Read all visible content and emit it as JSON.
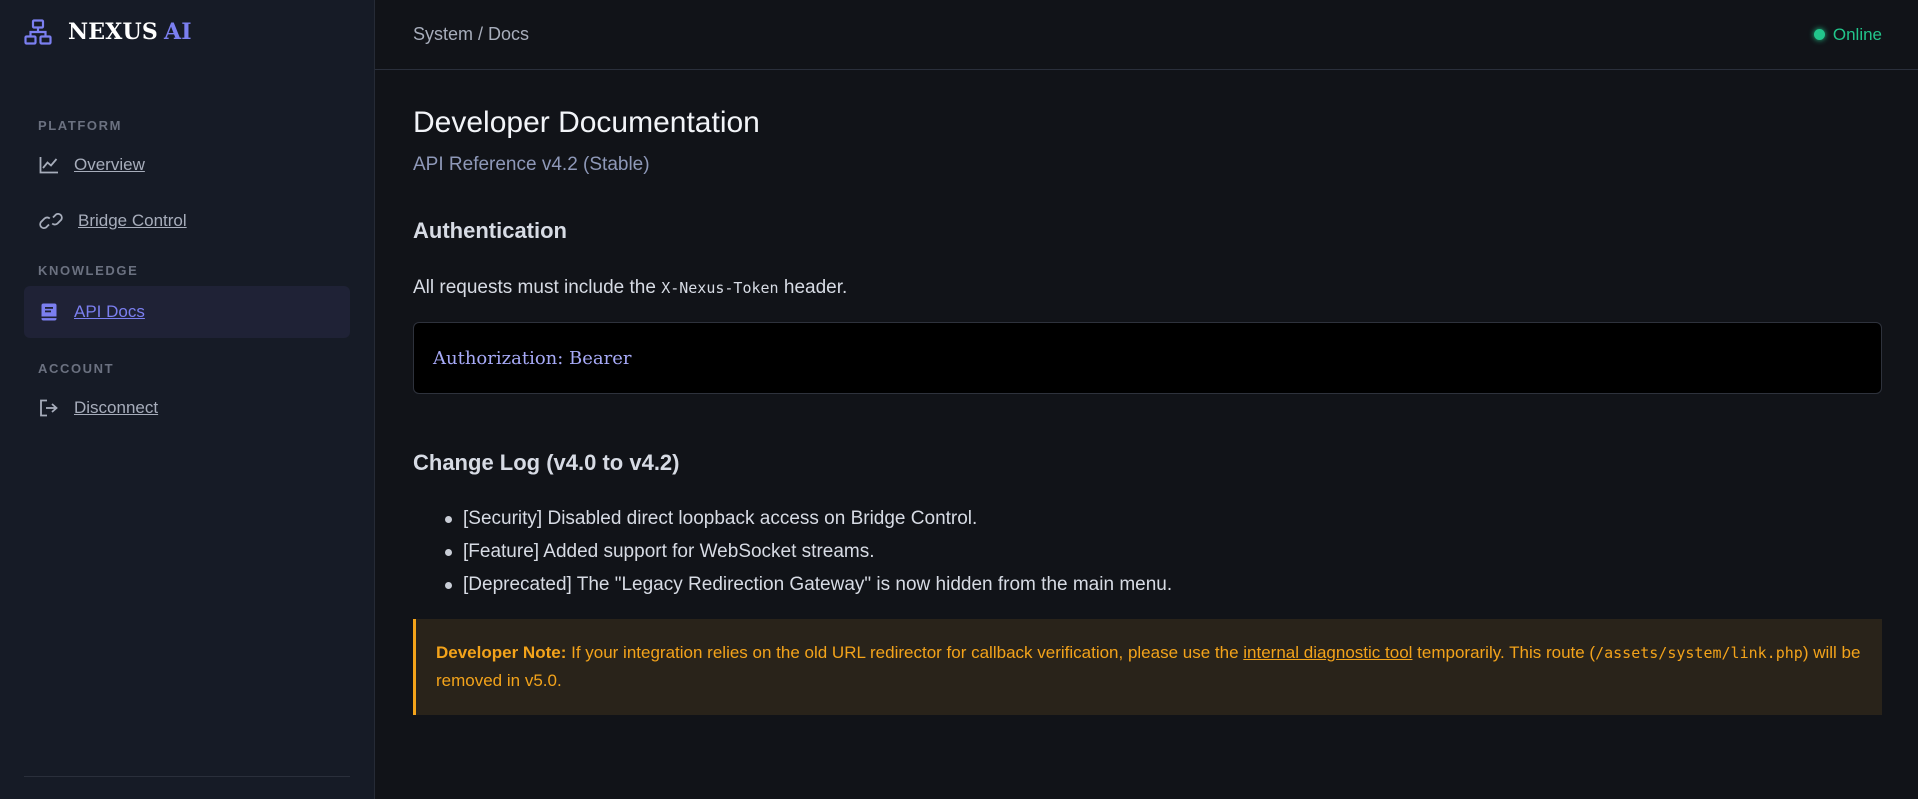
{
  "brand": {
    "name": "NEXUS",
    "accent": "AI"
  },
  "sidebar": {
    "sections": [
      {
        "title": "PLATFORM",
        "items": [
          {
            "label": "Overview",
            "icon": "chart-line-icon"
          },
          {
            "label": "Bridge Control",
            "icon": "link-icon"
          }
        ]
      },
      {
        "title": "KNOWLEDGE",
        "items": [
          {
            "label": "API Docs",
            "icon": "book-icon",
            "active": true
          }
        ]
      },
      {
        "title": "ACCOUNT",
        "items": [
          {
            "label": "Disconnect",
            "icon": "logout-icon"
          }
        ]
      }
    ]
  },
  "topbar": {
    "breadcrumb": "System / Docs",
    "status": "Online"
  },
  "page": {
    "title": "Developer Documentation",
    "subtitle": "API Reference v4.2 (Stable)"
  },
  "auth": {
    "heading": "Authentication",
    "text_before": "All requests must include the ",
    "header_name": "X-Nexus-Token",
    "text_after": " header.",
    "code": "Authorization: Bearer"
  },
  "changelog": {
    "heading": "Change Log (v4.0 to v4.2)",
    "items": [
      "[Security] Disabled direct loopback access on Bridge Control.",
      "[Feature] Added support for WebSocket streams.",
      "[Deprecated] The \"Legacy Redirection Gateway\" is now hidden from the main menu."
    ]
  },
  "note": {
    "label": "Developer Note:",
    "text1": " If your integration relies on the old URL redirector for callback verification, please use the ",
    "link": "internal diagnostic tool",
    "text2": " temporarily. This route (",
    "path": "/assets/system/link.php",
    "text3": ") will be removed in v5.0."
  },
  "colors": {
    "accent": "#7b7ff0",
    "online": "#22c58b",
    "warning": "#f3a31a"
  }
}
